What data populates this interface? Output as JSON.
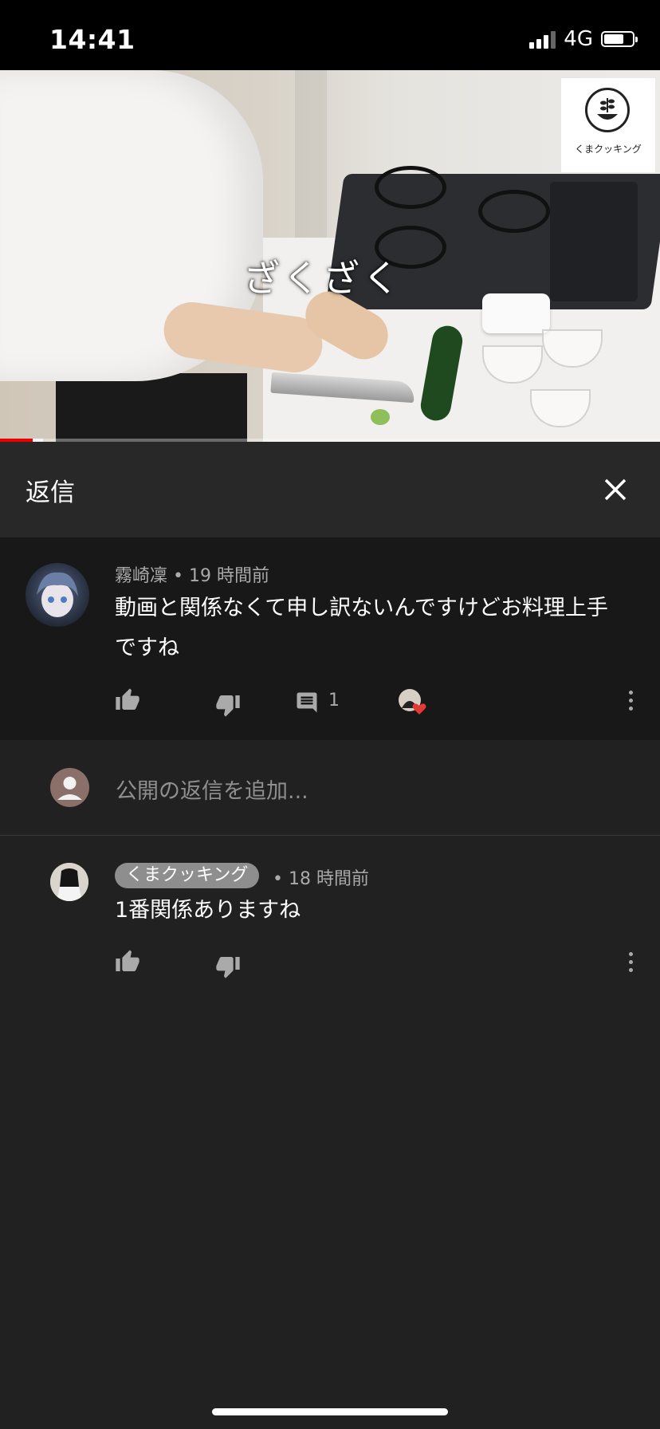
{
  "status_bar": {
    "time": "14:41",
    "network": "4G"
  },
  "video": {
    "subtitle": "ざくざく",
    "logo_text": "くまクッキング",
    "progress": 0.05,
    "buffered": 0.065,
    "colors": {
      "played": "#ee0000"
    }
  },
  "panel": {
    "title": "返信",
    "close_icon": "close-icon"
  },
  "parent_comment": {
    "author": "霧崎凜",
    "time": "19 時間前",
    "text_line1": "動画と関係なくて申し訳ないんですけどお料理上手",
    "text_line2": "ですね",
    "reply_count": "1",
    "icons": [
      "thumb-up-icon",
      "thumb-down-icon",
      "comment-icon",
      "creator-heart-icon",
      "more-vert-icon"
    ]
  },
  "add_reply": {
    "placeholder": "公開の返信を追加..."
  },
  "reply": {
    "author": "くまクッキング",
    "time": "18 時間前",
    "text": "1番関係ありますね"
  }
}
